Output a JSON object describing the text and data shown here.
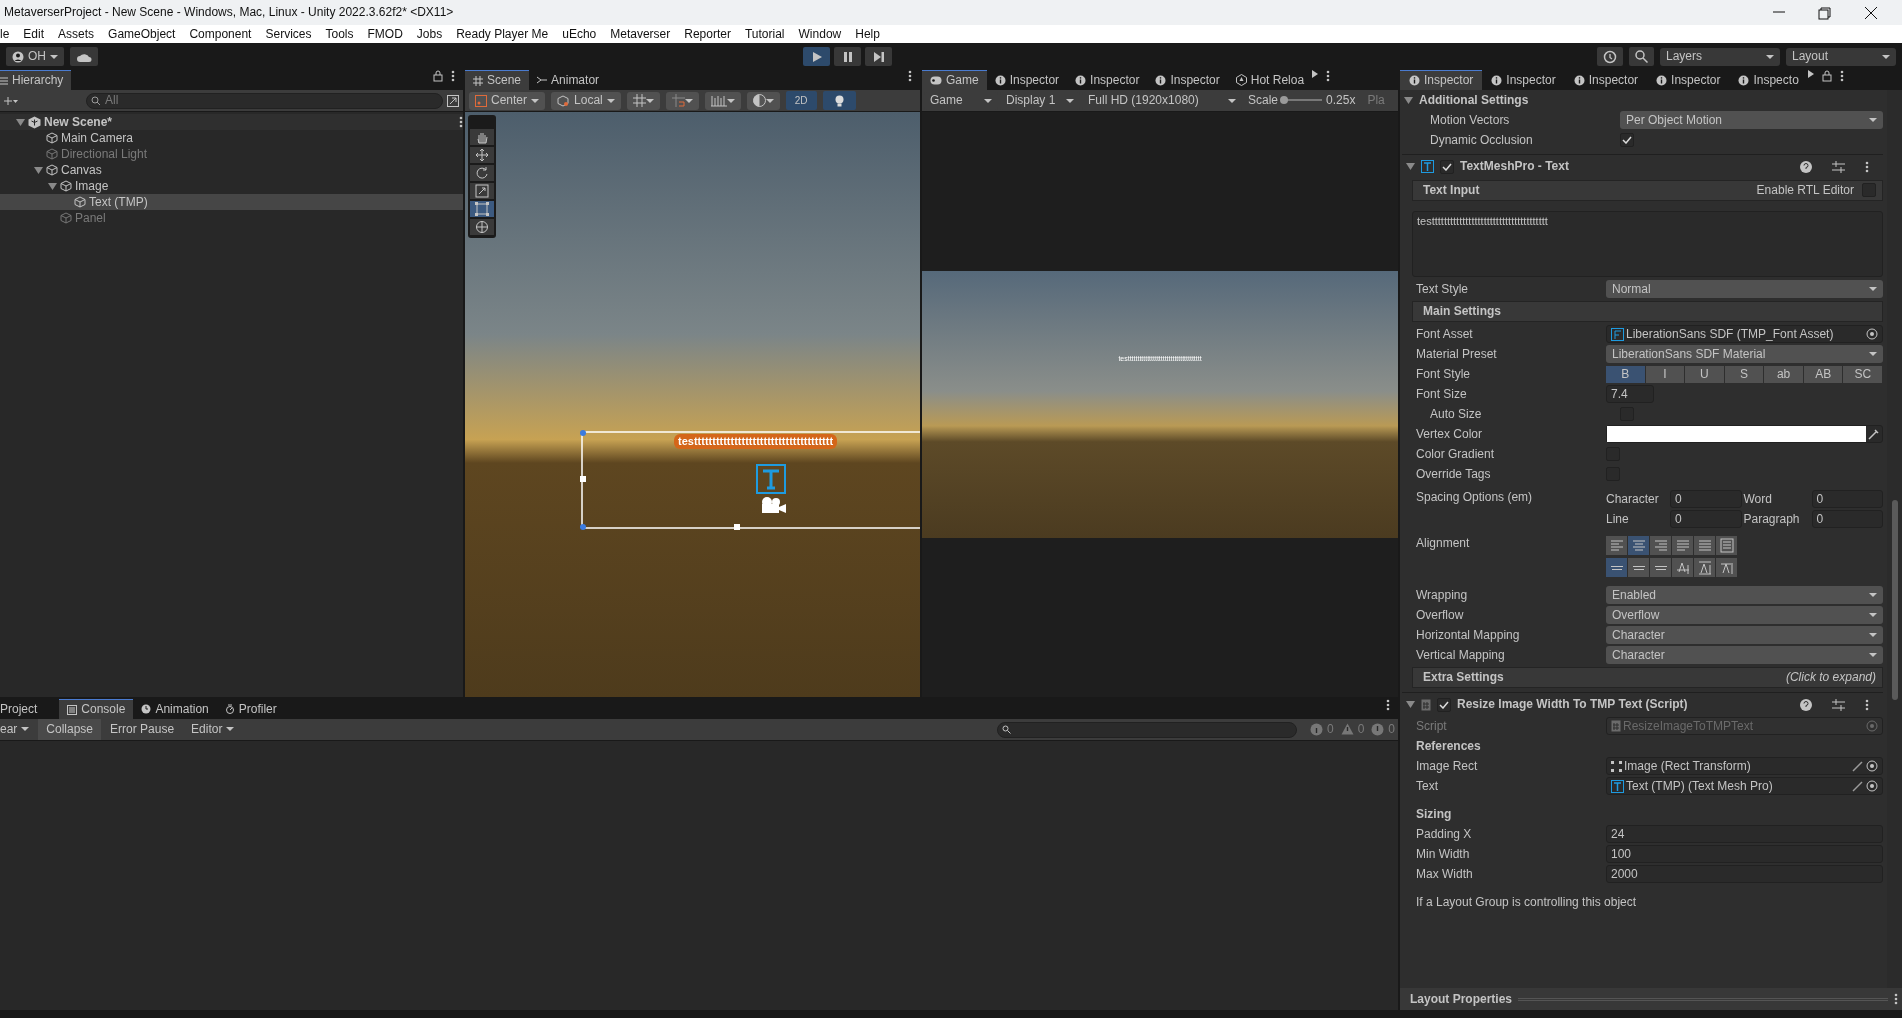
{
  "window": {
    "title": "MetaverserProject - New Scene - Windows, Mac, Linux - Unity 2022.3.62f2* <DX11>"
  },
  "menu": [
    "le",
    "Edit",
    "Assets",
    "GameObject",
    "Component",
    "Services",
    "Tools",
    "FMOD",
    "Jobs",
    "Ready Player Me",
    "uEcho",
    "Metaverser",
    "Reporter",
    "Tutorial",
    "Window",
    "Help"
  ],
  "toolbar": {
    "account": "OH",
    "play": [
      {
        "kind": "play",
        "selected": true
      },
      {
        "kind": "pause",
        "selected": false
      },
      {
        "kind": "step",
        "selected": false
      }
    ],
    "layers": "Layers",
    "layout": "Layout"
  },
  "hierarchy": {
    "tab": "Hierarchy",
    "search_placeholder": "All",
    "scene": "New Scene*",
    "items": [
      {
        "name": "Main Camera",
        "active": true,
        "selected": false
      },
      {
        "name": "Directional Light",
        "active": false,
        "selected": false
      },
      {
        "name": "Canvas",
        "active": true,
        "selected": false,
        "children": [
          {
            "name": "Image",
            "active": true,
            "selected": false,
            "children": [
              {
                "name": "Text (TMP)",
                "active": true,
                "selected": true
              }
            ]
          },
          {
            "name": "Panel",
            "active": false,
            "selected": false
          }
        ]
      }
    ]
  },
  "scene": {
    "tabs": [
      {
        "label": "Scene",
        "selected": true
      },
      {
        "label": "Animator",
        "selected": false
      }
    ],
    "pivot": "Center",
    "space": "Local",
    "mode_2d": {
      "label": "2D",
      "selected": true
    },
    "lighting_on": true,
    "tools": [
      {
        "kind": "hand",
        "selected": false
      },
      {
        "kind": "move",
        "selected": false
      },
      {
        "kind": "rotate",
        "selected": false
      },
      {
        "kind": "scale",
        "selected": false
      },
      {
        "kind": "rect",
        "selected": true
      },
      {
        "kind": "transform",
        "selected": false
      }
    ],
    "rendered_text": "testttttttttttttttttttttttttttttttttttttt"
  },
  "game": {
    "tabs": [
      {
        "label": "Game",
        "selected": true
      },
      {
        "label": "Inspector",
        "selected": false
      },
      {
        "label": "Inspector",
        "selected": false
      },
      {
        "label": "Inspector",
        "selected": false
      },
      {
        "label": "Hot Reloa",
        "selected": false
      }
    ],
    "view": "Game",
    "display": "Display 1",
    "resolution": "Full HD (1920x1080)",
    "scale_label": "Scale",
    "scale": {
      "level": 0.05
    },
    "scale_value": "0.25x",
    "play_mode": "Pla",
    "rendered_text": "testttttttttttttttttttttttttttttttttttttt"
  },
  "inspector": {
    "tabs": [
      {
        "label": "Inspector",
        "selected": true
      },
      {
        "label": "Inspector",
        "selected": false
      },
      {
        "label": "Inspector",
        "selected": false
      },
      {
        "label": "Inspector",
        "selected": false
      },
      {
        "label": "Inspecto",
        "selected": false
      }
    ],
    "rows": [
      {
        "kind": "foldout",
        "label": "Additional Settings",
        "children": [
          {
            "kind": "dropdown",
            "label": "Motion Vectors",
            "value": "Per Object Motion"
          },
          {
            "kind": "checkbox",
            "label": "Dynamic Occlusion",
            "checked": true
          }
        ]
      },
      {
        "kind": "text_component",
        "title": "TextMeshPro - Text",
        "enabled": true,
        "rows": [
          {
            "kind": "section",
            "label": "Text Input",
            "toggle_label": "Enable RTL Editor",
            "toggle_checked": false
          },
          {
            "kind": "textarea",
            "value": "testttttttttttttttttttttttttttttttttttttt"
          },
          {
            "kind": "dropdown",
            "label": "Text Style",
            "value": "Normal"
          },
          {
            "kind": "section",
            "label": "Main Settings"
          },
          {
            "kind": "font_ref",
            "label": "Font Asset",
            "value": "LiberationSans SDF (TMP_Font Asset)"
          },
          {
            "kind": "dropdown",
            "label": "Material Preset",
            "value": "LiberationSans SDF Material"
          },
          {
            "kind": "toggles",
            "label": "Font Style",
            "options": [
              {
                "label": "B",
                "selected": true
              },
              {
                "label": "I",
                "selected": false
              },
              {
                "label": "U",
                "selected": false
              },
              {
                "label": "S",
                "selected": false
              },
              {
                "label": "ab",
                "selected": false
              },
              {
                "label": "AB",
                "selected": false
              },
              {
                "label": "SC",
                "selected": false
              }
            ]
          },
          {
            "kind": "small_number",
            "label": "Font Size",
            "value": "7.4",
            "children": [
              {
                "kind": "checkbox",
                "label": "Auto Size",
                "checked": false
              }
            ]
          },
          {
            "kind": "color",
            "label": "Vertex Color",
            "color": "#ffffff"
          },
          {
            "kind": "checkbox",
            "label": "Color Gradient",
            "checked": false
          },
          {
            "kind": "checkbox",
            "label": "Override Tags",
            "checked": false
          },
          {
            "kind": "spacing",
            "label": "Spacing Options (em)",
            "fields": [
              {
                "label": "Character",
                "value": "0"
              },
              {
                "label": "Word",
                "value": "0"
              },
              {
                "label": "Line",
                "value": "0"
              },
              {
                "label": "Paragraph",
                "value": "0"
              }
            ]
          },
          {
            "kind": "alignment",
            "label": "Alignment",
            "rows": [
              [
                {
                  "selected": false
                },
                {
                  "selected": true
                },
                {
                  "selected": false
                },
                {
                  "selected": false
                },
                {
                  "selected": false
                },
                {
                  "selected": false
                }
              ],
              [
                {
                  "selected": true
                },
                {
                  "selected": false
                },
                {
                  "selected": false
                },
                {
                  "selected": false
                },
                {
                  "selected": false
                },
                {
                  "selected": false
                }
              ]
            ]
          },
          {
            "kind": "dropdown",
            "label": "Wrapping",
            "value": "Enabled"
          },
          {
            "kind": "dropdown",
            "label": "Overflow",
            "value": "Overflow"
          },
          {
            "kind": "dropdown",
            "label": "Horizontal Mapping",
            "value": "Character"
          },
          {
            "kind": "dropdown",
            "label": "Vertical Mapping",
            "value": "Character"
          },
          {
            "kind": "section",
            "label": "Extra Settings",
            "hint": "(Click to expand)"
          }
        ]
      },
      {
        "kind": "script_component",
        "title": "Resize Image Width To TMP Text (Script)",
        "enabled": true,
        "rows": [
          {
            "kind": "script_ref",
            "label": "Script",
            "value": "ResizeImageToTMPText",
            "disabled": true
          },
          {
            "kind": "heading",
            "label": "References"
          },
          {
            "kind": "rect_ref",
            "label": "Image Rect",
            "value": "Image (Rect Transform)",
            "editable": true
          },
          {
            "kind": "text_ref",
            "label": "Text",
            "value": "Text (TMP) (Text Mesh Pro)",
            "editable": true
          },
          {
            "kind": "heading",
            "label": "Sizing"
          },
          {
            "kind": "number",
            "label": "Padding X",
            "value": "24"
          },
          {
            "kind": "number",
            "label": "Min Width",
            "value": "100"
          },
          {
            "kind": "number",
            "label": "Max Width",
            "value": "2000"
          },
          {
            "kind": "note",
            "text": "If a Layout Group is controlling this object"
          }
        ]
      }
    ],
    "footer": "Layout Properties"
  },
  "console": {
    "tabs": [
      {
        "label": "Project",
        "selected": false
      },
      {
        "label": "Console",
        "selected": true
      },
      {
        "label": "Animation",
        "selected": false
      },
      {
        "label": "Profiler",
        "selected": false
      }
    ],
    "clear": "ear",
    "collapse": {
      "label": "Collapse",
      "selected": true
    },
    "error_pause": {
      "label": "Error Pause",
      "selected": false
    },
    "editor": "Editor",
    "counts": [
      {
        "kind": "info",
        "value": "0"
      },
      {
        "kind": "warning",
        "value": "0"
      },
      {
        "kind": "error",
        "value": "0"
      }
    ]
  }
}
